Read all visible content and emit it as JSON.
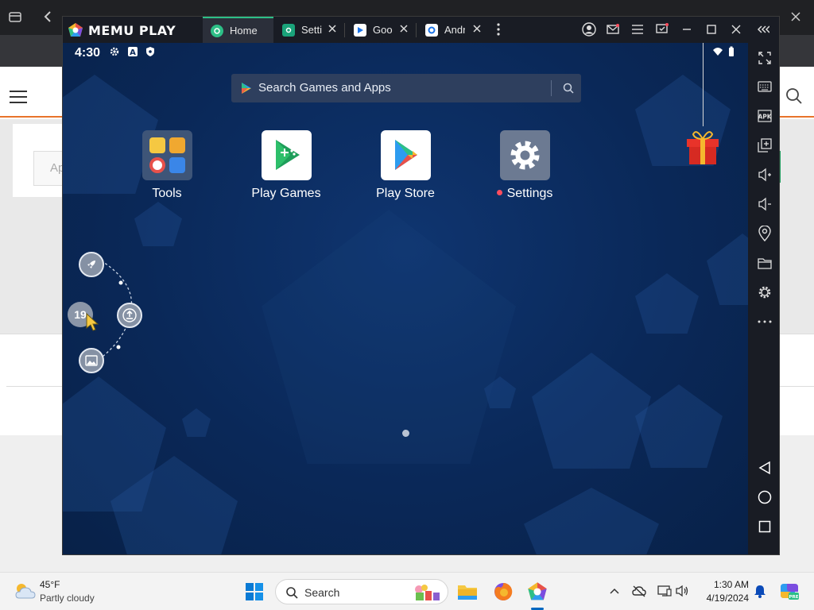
{
  "memu": {
    "brand": "MEMU PLAY",
    "tabs": [
      {
        "label": "Home",
        "active": true
      },
      {
        "label": "Setti"
      },
      {
        "label": "Goo"
      },
      {
        "label": "Andr"
      }
    ]
  },
  "android": {
    "status": {
      "time": "4:30"
    },
    "search": {
      "placeholder": "Search Games and Apps"
    },
    "apps": [
      {
        "label": "Tools"
      },
      {
        "label": "Play Games"
      },
      {
        "label": "Play Store"
      },
      {
        "label": "Settings",
        "has_notification": true
      }
    ],
    "float_badge": "19"
  },
  "background_page": {
    "input_placeholder": "Ap"
  },
  "taskbar": {
    "weather": {
      "temp": "45°F",
      "desc": "Partly cloudy"
    },
    "search_label": "Search",
    "clock": {
      "time": "1:30 AM",
      "date": "4/19/2024"
    }
  },
  "colors": {
    "memu_accent": "#2dbf87",
    "android_bg": "#0a2858",
    "titlebar": "#191c24",
    "header_rule": "#e8732a"
  }
}
